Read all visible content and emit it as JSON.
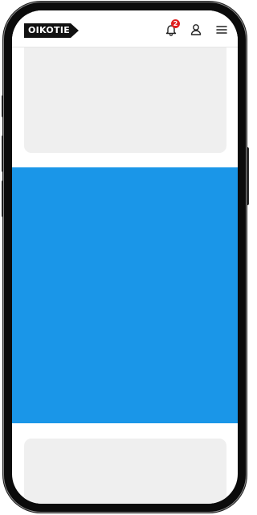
{
  "header": {
    "logo_text": "OIKOTIE",
    "notification_count": "2"
  },
  "colors": {
    "banner": "#1a96e8",
    "placeholder": "#efefef",
    "badge": "#e02020",
    "logo": "#111111"
  },
  "icons": [
    "bell-icon",
    "user-icon",
    "hamburger-menu-icon"
  ]
}
